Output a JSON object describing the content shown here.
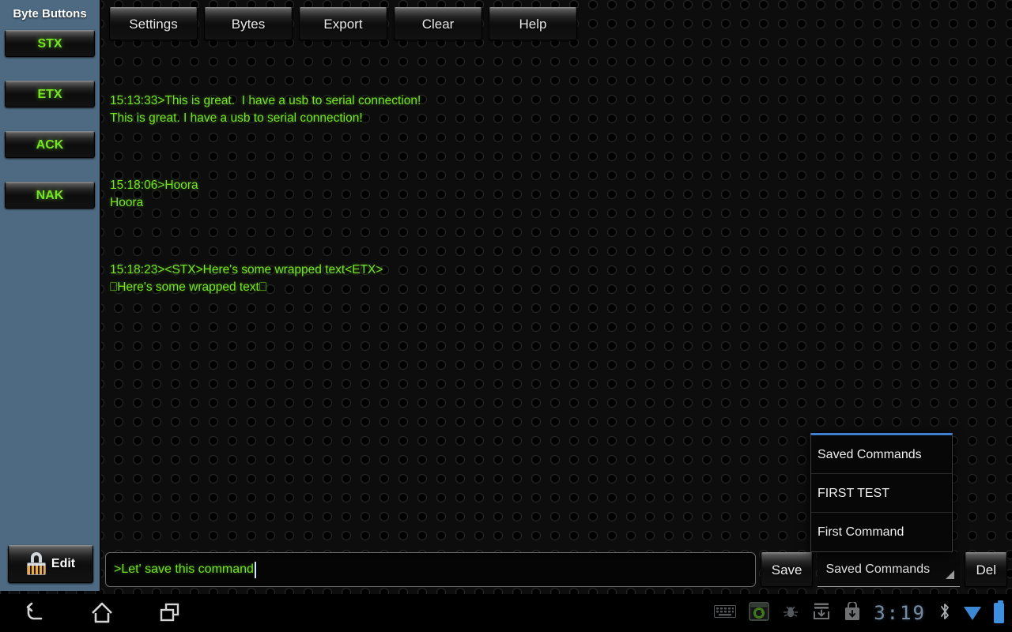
{
  "sidebar": {
    "title": "Byte Buttons",
    "byte_buttons": [
      {
        "label": "STX"
      },
      {
        "label": "ETX"
      },
      {
        "label": "ACK"
      },
      {
        "label": "NAK"
      }
    ],
    "edit_button": {
      "label": "Edit",
      "icon": "lock-icon"
    }
  },
  "toolbar": {
    "buttons": [
      {
        "label": "Settings"
      },
      {
        "label": "Bytes"
      },
      {
        "label": "Export"
      },
      {
        "label": "Clear"
      },
      {
        "label": "Help"
      }
    ]
  },
  "terminal": {
    "blocks": [
      "15:13:33>This is great.  I have a usb to serial connection!\nThis is great. I have a usb to serial connection!",
      "15:18:06>Hoora\nHoora",
      "15:18:23><STX>Here's some wrapped text<ETX>\n⎕Here's some wrapped text⎕"
    ]
  },
  "input_bar": {
    "command_value": ">Let' save this command",
    "command_placeholder": "",
    "save_label": "Save",
    "spinner_selected": "Saved Commands",
    "delete_label": "Del"
  },
  "popup": {
    "options": [
      {
        "label": "Saved Commands"
      },
      {
        "label": "FIRST TEST"
      },
      {
        "label": "First Command"
      }
    ]
  },
  "system_bar": {
    "nav": [
      {
        "name": "back"
      },
      {
        "name": "home"
      },
      {
        "name": "recents"
      }
    ],
    "clock": "3:19",
    "tray": [
      {
        "name": "keyboard-icon"
      },
      {
        "name": "screenshot-app-icon"
      },
      {
        "name": "usb-debug-icon"
      },
      {
        "name": "download-icon"
      },
      {
        "name": "play-store-icon"
      },
      {
        "name": "bluetooth-icon"
      },
      {
        "name": "wifi-icon"
      },
      {
        "name": "battery-icon"
      }
    ]
  },
  "colors": {
    "sidebar_blue": "#4d6a82",
    "terminal_green": "#76e323",
    "popup_accent": "#3f7fd0",
    "status_blue": "#3f8fe0"
  }
}
